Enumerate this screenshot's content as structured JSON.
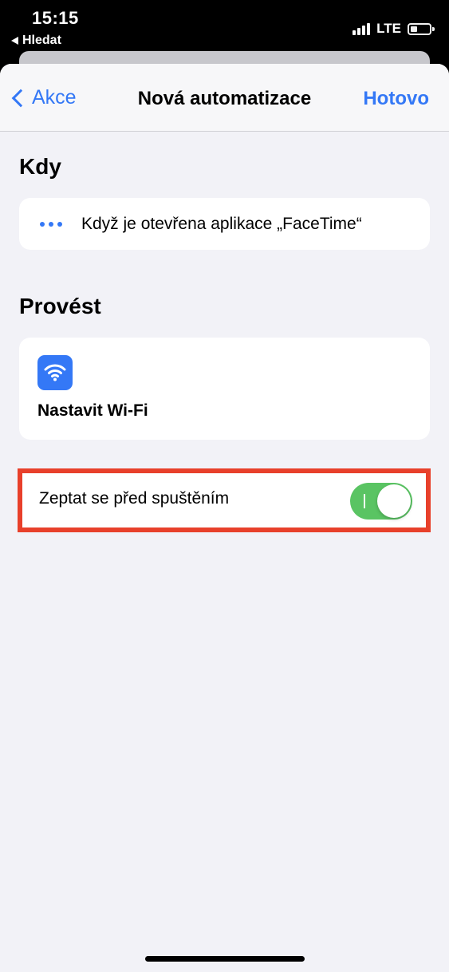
{
  "status_bar": {
    "time": "15:15",
    "back_app": "Hledat",
    "network": "LTE",
    "signal_bars": 4,
    "battery_level": 0.3
  },
  "nav": {
    "back_label": "Akce",
    "title": "Nová automatizace",
    "done_label": "Hotovo"
  },
  "when": {
    "section_title": "Kdy",
    "trigger_text": "Když je otevřena aplikace „FaceTime“",
    "icon": "ellipsis-icon"
  },
  "do": {
    "section_title": "Provést",
    "action_label": "Nastavit Wi-Fi",
    "icon": "wifi-icon"
  },
  "ask_before_running": {
    "label": "Zeptat se před spuštěním",
    "enabled": true
  },
  "colors": {
    "accent": "#3478f6",
    "toggle_on": "#5ac463",
    "highlight_border": "#e8402b",
    "background": "#f2f2f7"
  }
}
